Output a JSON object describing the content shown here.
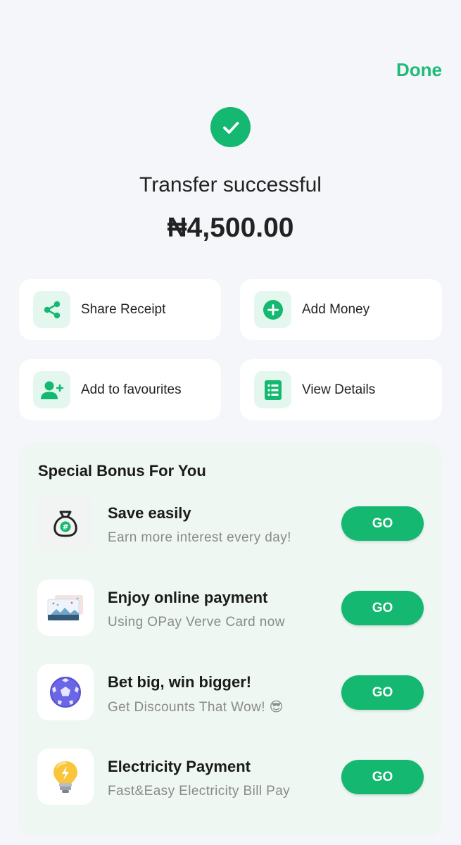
{
  "header": {
    "done_label": "Done"
  },
  "result": {
    "status_text": "Transfer successful",
    "amount": "₦4,500.00"
  },
  "actions": [
    {
      "label": "Share Receipt",
      "icon": "share-icon"
    },
    {
      "label": "Add Money",
      "icon": "add-circle-icon"
    },
    {
      "label": "Add to favourites",
      "icon": "add-person-icon"
    },
    {
      "label": "View Details",
      "icon": "document-list-icon"
    }
  ],
  "bonus": {
    "title": "Special Bonus For You",
    "items": [
      {
        "title": "Save easily",
        "subtitle": "Earn more interest every day!",
        "button": "GO",
        "icon": "money-bag-icon"
      },
      {
        "title": "Enjoy online payment",
        "subtitle": "Using OPay Verve Card now",
        "button": "GO",
        "icon": "card-icon"
      },
      {
        "title": "Bet big, win bigger!",
        "subtitle": "Get Discounts That Wow! 😎",
        "button": "GO",
        "icon": "football-icon"
      },
      {
        "title": "Electricity Payment",
        "subtitle": "Fast&Easy Electricity Bill Pay",
        "button": "GO",
        "icon": "lightbulb-icon"
      }
    ]
  },
  "colors": {
    "accent": "#14b870",
    "accent_text": "#1dbb77",
    "icon_bg": "#e4f7ee",
    "bonus_bg": "#eef7f1",
    "page_bg": "#f5f6fa"
  }
}
